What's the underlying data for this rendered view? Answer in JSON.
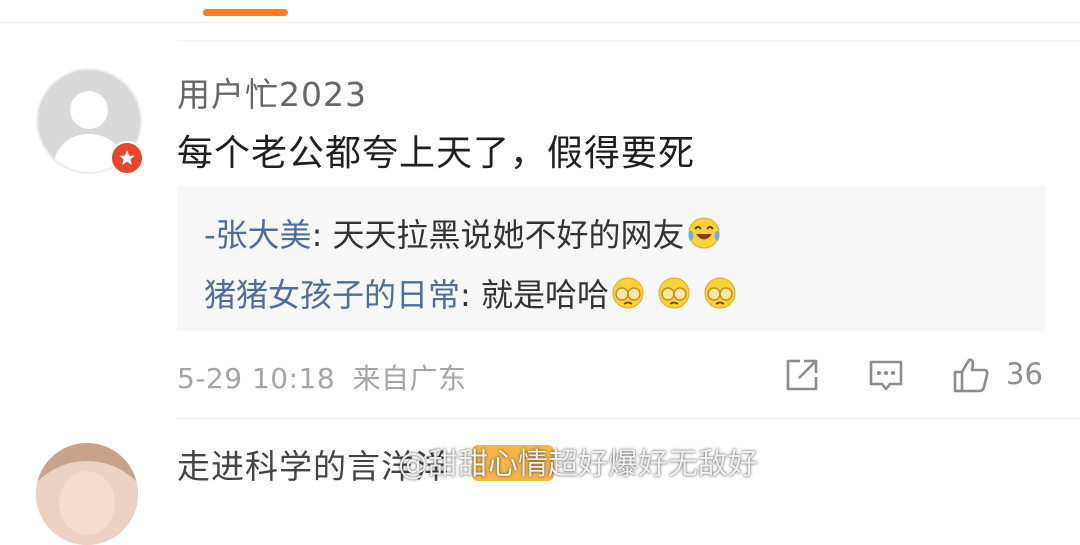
{
  "comment": {
    "username": "用户忙2023",
    "text": "每个老公都夸上天了，假得要死",
    "replies": [
      {
        "author": "-张大美",
        "text": ": 天天拉黑说她不好的网友",
        "emoji": [
          "laughing-tears-emoji"
        ]
      },
      {
        "author": "猪猪女孩子的日常",
        "text": ": 就是哈哈",
        "emoji": [
          "facepalm-emoji",
          "facepalm-emoji",
          "facepalm-emoji"
        ]
      }
    ],
    "timestamp": "5-29 10:18",
    "location": "来自广东",
    "like_count": "36",
    "actions": [
      "share-icon",
      "reply-icon",
      "like-icon"
    ]
  },
  "next_comment": {
    "username": "走进科学的言洋洋",
    "tag": "svip-tag"
  },
  "watermark": "@甜甜心情超好爆好无敌好",
  "colors": {
    "tab_indicator": "#ff7d20",
    "reply_author": "#4e6d9c",
    "badge": "#e8442e",
    "meta_text": "#a5a5a5",
    "reply_background": "#f7f7f7"
  }
}
